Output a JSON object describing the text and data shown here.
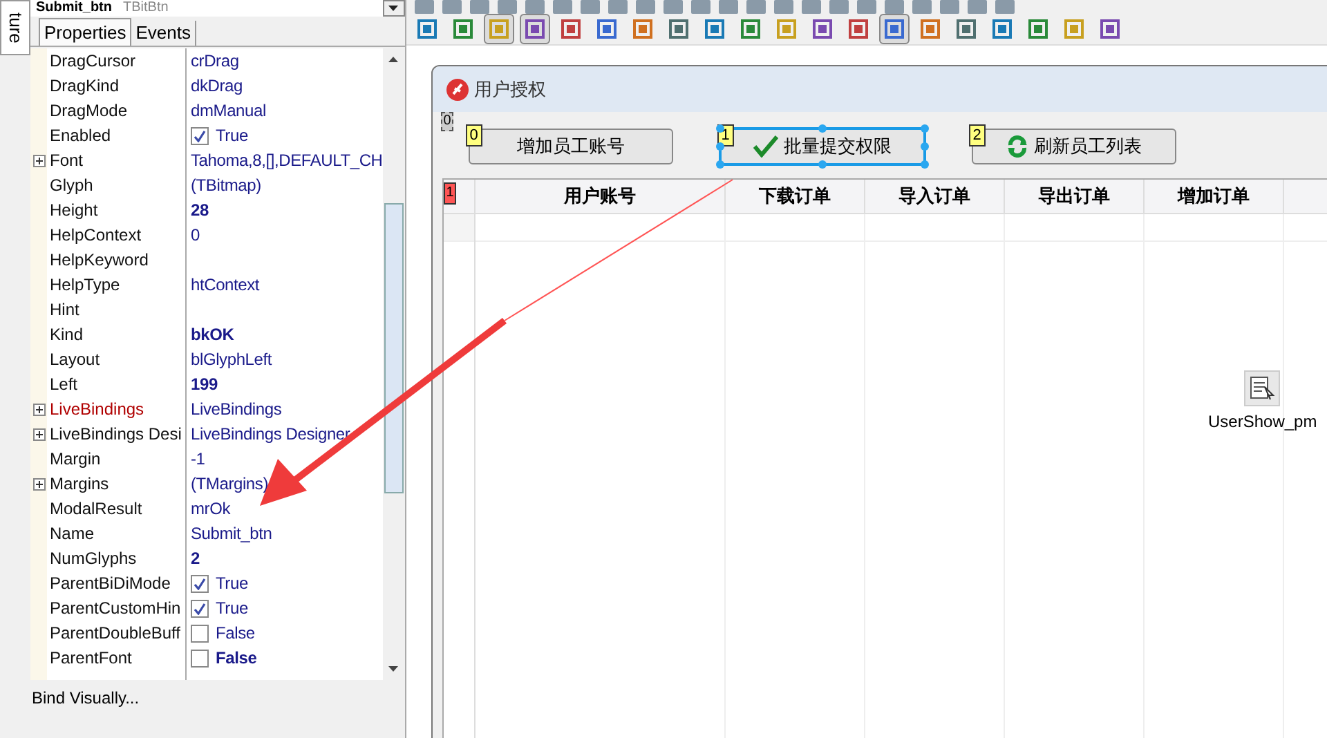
{
  "side_tab": {
    "label": "ture"
  },
  "inspector": {
    "component": "Submit_btn",
    "type": "TBitBtn",
    "tabs": [
      {
        "label": "Properties",
        "selected": true
      },
      {
        "label": "Events",
        "selected": false
      }
    ],
    "properties": [
      {
        "name": "DragCursor",
        "value": "crDrag",
        "kind": "text"
      },
      {
        "name": "DragKind",
        "value": "dkDrag",
        "kind": "text"
      },
      {
        "name": "DragMode",
        "value": "dmManual",
        "kind": "text"
      },
      {
        "name": "Enabled",
        "value": "True",
        "kind": "check",
        "checked": true
      },
      {
        "name": "Font",
        "value": "Tahoma,8,[],DEFAULT_CH",
        "kind": "text",
        "expandable": true
      },
      {
        "name": "Glyph",
        "value": "(TBitmap)",
        "kind": "text"
      },
      {
        "name": "Height",
        "value": "28",
        "kind": "bold"
      },
      {
        "name": "HelpContext",
        "value": "0",
        "kind": "text"
      },
      {
        "name": "HelpKeyword",
        "kind": "text"
      },
      {
        "name": "HelpType",
        "value": "htContext",
        "kind": "text"
      },
      {
        "name": "Hint",
        "kind": "text"
      },
      {
        "name": "Kind",
        "value": "bkOK",
        "kind": "bold"
      },
      {
        "name": "Layout",
        "value": "blGlyphLeft",
        "kind": "text"
      },
      {
        "name": "Left",
        "value": "199",
        "kind": "bold"
      },
      {
        "name": "LiveBindings",
        "value": "LiveBindings",
        "kind": "text",
        "expandable": true,
        "highlighted": true
      },
      {
        "name": "LiveBindings Desi",
        "value": "LiveBindings Designer",
        "kind": "text",
        "expandable": true
      },
      {
        "name": "Margin",
        "value": "-1",
        "kind": "text"
      },
      {
        "name": "Margins",
        "value": "(TMargins)",
        "kind": "text",
        "expandable": true
      },
      {
        "name": "ModalResult",
        "value": "mrOk",
        "kind": "text"
      },
      {
        "name": "Name",
        "value": "Submit_btn",
        "kind": "text"
      },
      {
        "name": "NumGlyphs",
        "value": "2",
        "kind": "bold"
      },
      {
        "name": "ParentBiDiMode",
        "value": "True",
        "kind": "check",
        "checked": true
      },
      {
        "name": "ParentCustomHin",
        "value": "True",
        "kind": "check",
        "checked": true
      },
      {
        "name": "ParentDoubleBuff",
        "value": "False",
        "kind": "check",
        "checked": false
      },
      {
        "name": "ParentFont",
        "value": "False",
        "kind": "checkbold",
        "checked": false
      }
    ],
    "footer": "Bind Visually..."
  },
  "toolbar_buttons": [
    {
      "pressed": false
    },
    {
      "pressed": false
    },
    {
      "pressed": true
    },
    {
      "pressed": true
    },
    {
      "pressed": false
    },
    {
      "pressed": false
    },
    {
      "pressed": false
    },
    {
      "pressed": false
    },
    {
      "pressed": false
    },
    {
      "pressed": false
    },
    {
      "pressed": false
    },
    {
      "pressed": false
    },
    {
      "pressed": false
    },
    {
      "pressed": true
    },
    {
      "pressed": false
    },
    {
      "pressed": false
    },
    {
      "pressed": false
    },
    {
      "pressed": false
    },
    {
      "pressed": false
    },
    {
      "pressed": false
    }
  ],
  "form": {
    "title": "用户授权",
    "panel_order": "0",
    "buttons": [
      {
        "label": "增加员工账号",
        "order": "0",
        "kind": "plain",
        "selected": false
      },
      {
        "label": "批量提交权限",
        "order": "1",
        "kind": "check",
        "selected": true
      },
      {
        "label": "刷新员工列表",
        "order": "2",
        "kind": "refresh",
        "selected": false
      }
    ],
    "grid": {
      "order": "1",
      "columns": [
        "用户账号",
        "下载订单",
        "导入订单",
        "导出订单",
        "增加订单",
        ""
      ]
    },
    "component": {
      "label": "UserShow_pm"
    }
  }
}
